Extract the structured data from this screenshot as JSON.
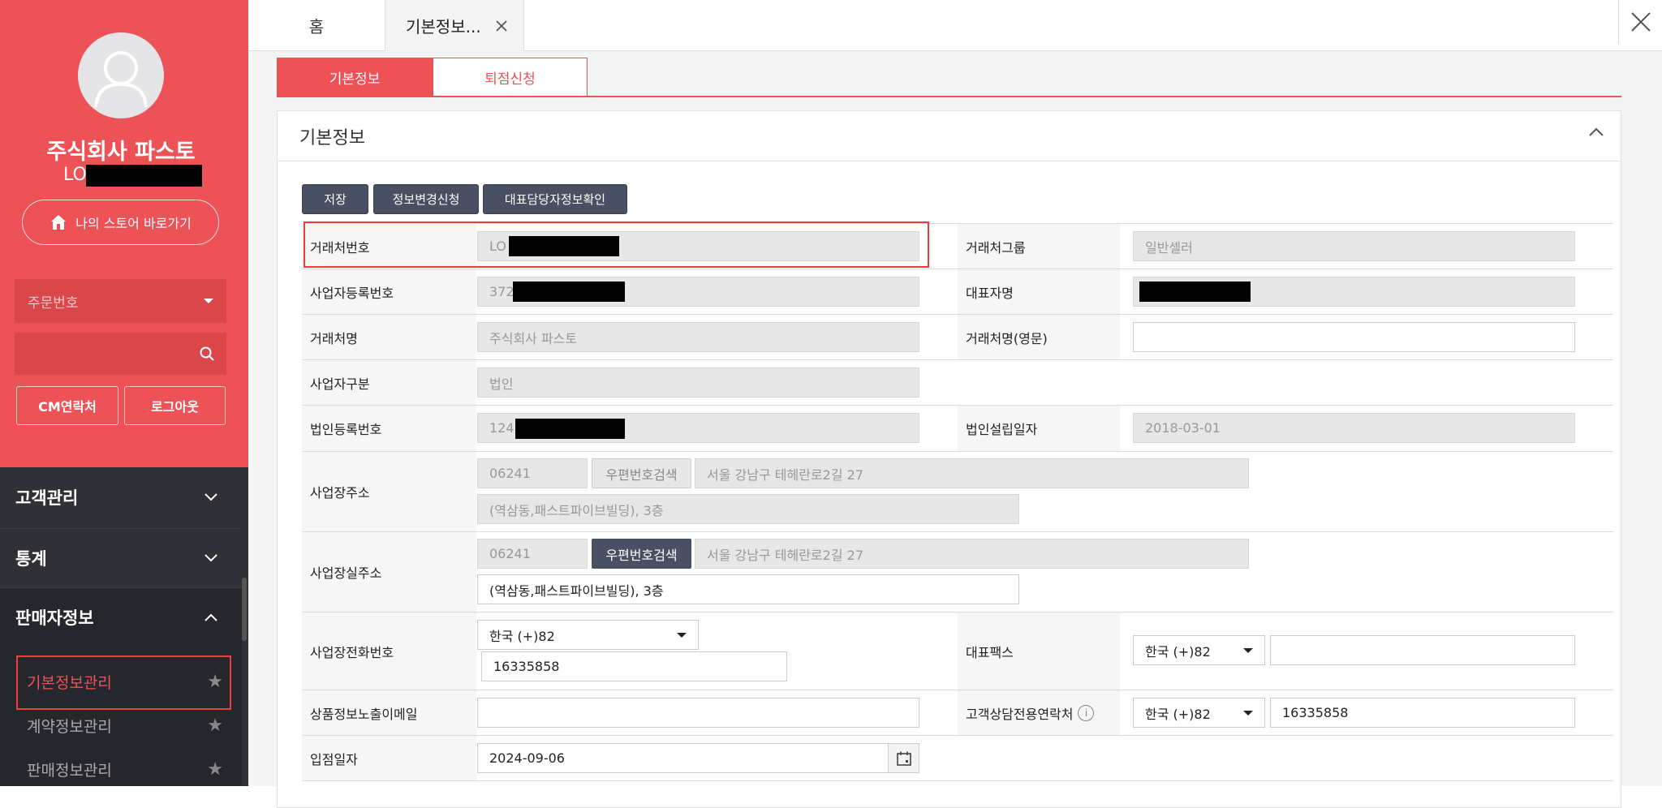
{
  "sidebar": {
    "company_name": "주식회사 파스토",
    "user_id_prefix": "LO",
    "store_link": "나의 스토어 바로가기",
    "order_select": "주문번호",
    "search_value": "",
    "cm_contact": "CM연락처",
    "logout": "로그아웃",
    "nav": [
      {
        "label": "고객관리"
      },
      {
        "label": "통계"
      },
      {
        "label": "판매자정보"
      }
    ],
    "sub_items": [
      {
        "label": "기본정보관리"
      },
      {
        "label": "계약정보관리"
      },
      {
        "label": "판매정보관리"
      }
    ]
  },
  "tabs": [
    {
      "label": "홈"
    },
    {
      "label": "기본정보..."
    }
  ],
  "subtabs": [
    {
      "label": "기본정보"
    },
    {
      "label": "퇴점신청"
    }
  ],
  "panel": {
    "title": "기본정보",
    "buttons": {
      "save": "저장",
      "change_request": "정보변경신청",
      "rep_info": "대표담당자정보확인"
    }
  },
  "form": {
    "partner_no": {
      "label": "거래처번호",
      "value": "LO"
    },
    "partner_group": {
      "label": "거래처그룹",
      "value": "일반셀러"
    },
    "biz_reg_no": {
      "label": "사업자등록번호",
      "value": "372"
    },
    "ceo_name": {
      "label": "대표자명",
      "value": ""
    },
    "partner_name": {
      "label": "거래처명",
      "value": "주식회사 파스토"
    },
    "partner_name_en": {
      "label": "거래처명(영문)",
      "value": ""
    },
    "biz_type": {
      "label": "사업자구분",
      "value": "법인"
    },
    "corp_reg_no": {
      "label": "법인등록번호",
      "value": "124"
    },
    "corp_est_date": {
      "label": "법인설립일자",
      "value": "2018-03-01"
    },
    "biz_address": {
      "label": "사업장주소",
      "zip": "06241",
      "zip_search": "우편번호검색",
      "addr1": "서울 강남구 테헤란로2길 27",
      "addr2": "(역삼동,패스트파이브빌딩), 3층"
    },
    "biz_real_address": {
      "label": "사업장실주소",
      "zip": "06241",
      "zip_search": "우편번호검색",
      "addr1": "서울 강남구 테헤란로2길 27",
      "addr2": "(역삼동,패스트파이브빌딩), 3층"
    },
    "biz_phone": {
      "label": "사업장전화번호",
      "country": "한국 (+)82",
      "number": "16335858"
    },
    "rep_fax": {
      "label": "대표팩스",
      "country": "한국 (+)82",
      "number": ""
    },
    "product_email": {
      "label": "상품정보노출이메일",
      "value": ""
    },
    "cs_phone": {
      "label": "고객상담전용연락처",
      "country": "한국 (+)82",
      "number": "16335858"
    },
    "entry_date": {
      "label": "입점일자",
      "value": "2024-09-06"
    }
  },
  "colors": {
    "brand_red": "#ec5256",
    "dark_button": "#4a5063",
    "sidebar_dark": "#2f3137"
  }
}
